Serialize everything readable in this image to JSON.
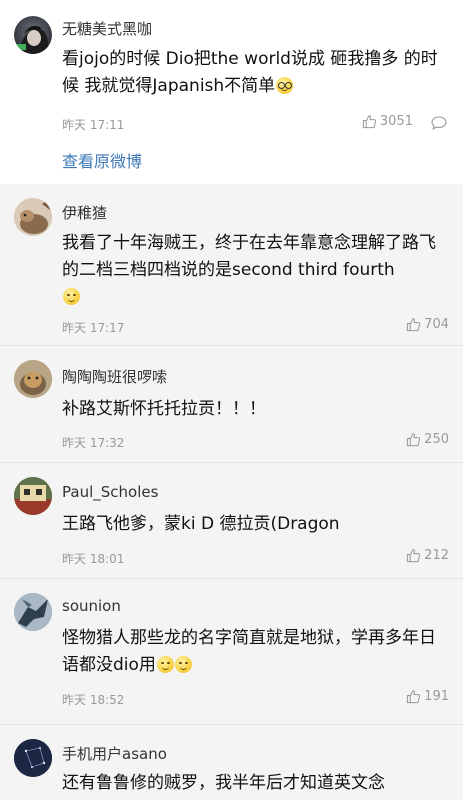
{
  "top_comment": {
    "username": "无糖美式黑咖",
    "text": "看jojo的时候 Dio把the world说成 砸我撸多 的时候 我就觉得Japanish不简单",
    "time": "昨天 17:11",
    "likes": "3051",
    "view_original": "查看原微博"
  },
  "comments": [
    {
      "username": "伊稚猹",
      "text": "我看了十年海贼王，终于在去年靠意念理解了路飞的二档三档四档说的是second third fourth",
      "time": "昨天 17:17",
      "likes": "704"
    },
    {
      "username": "陶陶陶班很啰嗦",
      "text": "补路艾斯怀托托拉贡！！！",
      "time": "昨天 17:32",
      "likes": "250"
    },
    {
      "username": "Paul_Scholes",
      "text": "王路飞他爹，蒙ki D 德拉贡(Dragon",
      "time": "昨天 18:01",
      "likes": "212"
    },
    {
      "username": "sounion",
      "text": "怪物猎人那些龙的名字简直就是地狱，学再多年日语都没dio用",
      "time": "昨天 18:52",
      "likes": "191"
    },
    {
      "username": "手机用户asano",
      "text": "还有鲁鲁修的贼罗，我半年后才知道英文念"
    }
  ],
  "colors": {
    "link": "#3d78b8",
    "meta": "#999999",
    "list_background": "#f4f4f4"
  },
  "icons": {
    "like": "thumbs-up-icon",
    "reply": "comment-bubble-icon",
    "emoji_smile": "smile-emoji-icon",
    "emoji_glasses": "glasses-emoji-icon"
  }
}
